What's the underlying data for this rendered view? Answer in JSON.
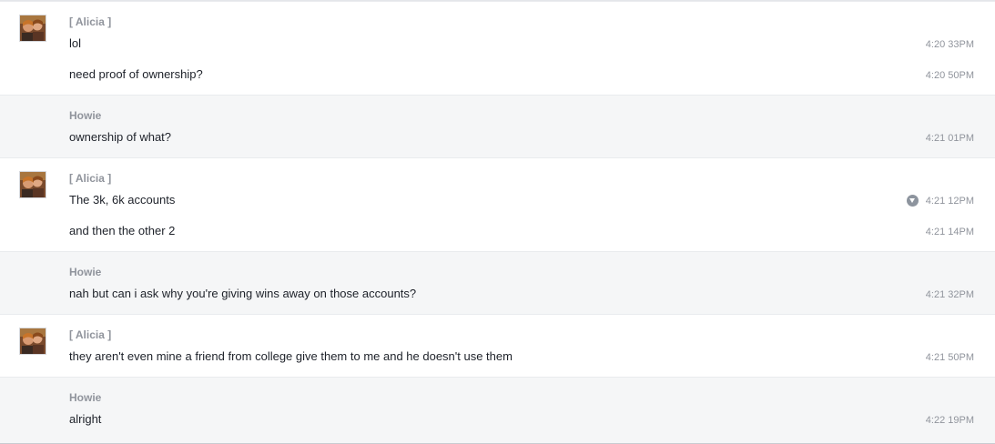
{
  "groups": [
    {
      "sender": "[ Alicia ]",
      "messages": [
        {
          "text": "lol",
          "time": "4:20 33PM"
        },
        {
          "text": "need proof of ownership?",
          "time": "4:20 50PM"
        }
      ]
    },
    {
      "sender": "Howie",
      "messages": [
        {
          "text": "ownership of what?",
          "time": "4:21 01PM"
        }
      ]
    },
    {
      "sender": "[ Alicia ]",
      "messages": [
        {
          "text": "The 3k, 6k accounts",
          "time": "4:21 12PM"
        },
        {
          "text": "and then the other 2",
          "time": "4:21 14PM"
        }
      ]
    },
    {
      "sender": "Howie",
      "messages": [
        {
          "text": "nah but can i ask why you're giving wins away on those accounts?",
          "time": "4:21 32PM"
        }
      ]
    },
    {
      "sender": "[ Alicia ]",
      "messages": [
        {
          "text": "they aren't even mine a friend from college give them to me and he doesn't use them",
          "time": "4:21 50PM"
        }
      ]
    },
    {
      "sender": "Howie",
      "messages": [
        {
          "text": "alright",
          "time": "4:22 19PM"
        }
      ]
    }
  ],
  "icons": {
    "avatar": "user-photo-avatar",
    "message_options": "chevron-down-circle-icon"
  },
  "colors": {
    "sender_name": "#90949c",
    "message_text": "#1d2129",
    "timestamp": "#90949c",
    "alt_row_background": "#f5f6f7"
  }
}
